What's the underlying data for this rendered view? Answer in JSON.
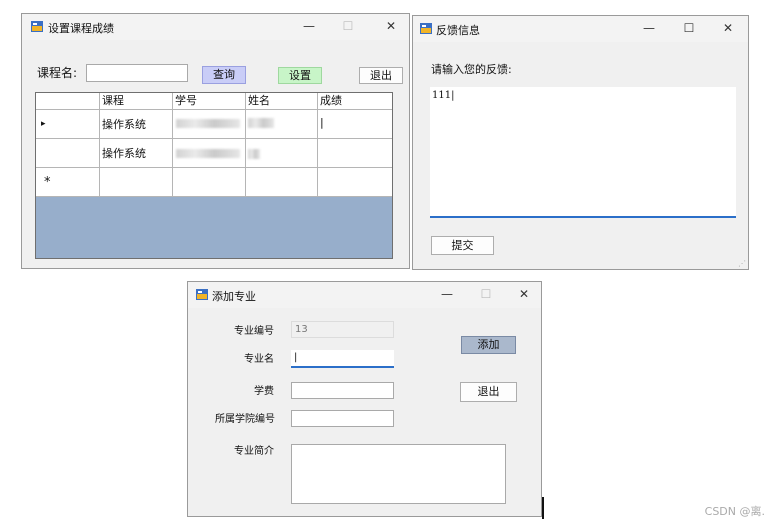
{
  "win_grade": {
    "title": "设置课程成绩",
    "course_label": "课程名:",
    "course_value": "",
    "query_label": "查询",
    "set_label": "设置",
    "exit_label": "退出",
    "headers": [
      "课程",
      "学号",
      "姓名",
      "成绩"
    ],
    "rows": [
      {
        "indicator": "▸",
        "course": "操作系统",
        "grade": "|"
      },
      {
        "indicator": "",
        "course": "操作系统",
        "grade": ""
      },
      {
        "indicator": "*",
        "course": "",
        "grade": ""
      }
    ]
  },
  "win_feedback": {
    "title": "反馈信息",
    "prompt": "请输入您的反馈:",
    "text": "111|",
    "submit_label": "提交"
  },
  "win_major": {
    "title": "添加专业",
    "id_label": "专业编号",
    "id_value": "13",
    "name_label": "专业名",
    "name_value": "|",
    "fee_label": "学费",
    "fee_value": "",
    "college_label": "所属学院编号",
    "college_value": "",
    "intro_label": "专业简介",
    "intro_value": "",
    "add_label": "添加",
    "exit_label": "退出"
  },
  "window_controls": {
    "minimize": "—",
    "maximize": "☐",
    "close": "✕"
  },
  "watermark": "CSDN @离."
}
